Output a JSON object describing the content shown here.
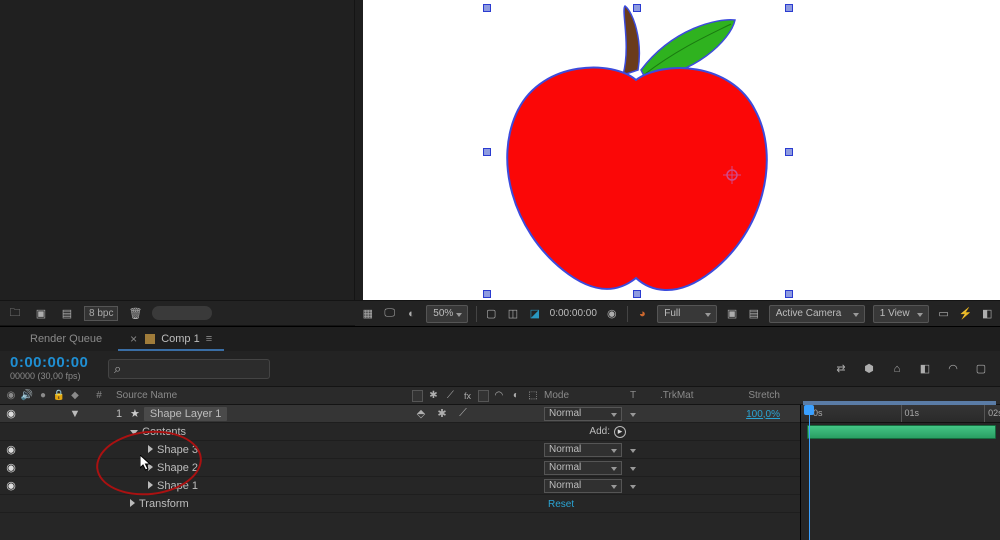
{
  "project_toolbar": {
    "bpc": "8 bpc"
  },
  "comp_toolbar": {
    "zoom": "50%",
    "time": "0:00:00:00",
    "resolution": "Full",
    "camera": "Active Camera",
    "views": "1 View"
  },
  "timeline": {
    "tabs": {
      "render_queue": "Render Queue",
      "comp": "Comp 1"
    },
    "timecode": "0:00:00:00",
    "timecode_sub": "00000 (30,00 fps)",
    "search_placeholder": "",
    "columns": {
      "index": "#",
      "source_name": "Source Name",
      "mode": "Mode",
      "t": "T",
      "trkmat": ".TrkMat",
      "stretch": "Stretch"
    },
    "layer": {
      "index": "1",
      "name": "Shape Layer 1",
      "mode": "Normal",
      "stretch": "100,0%"
    },
    "contents_label": "Contents",
    "add_label": "Add:",
    "shapes": [
      {
        "name": "Shape 3",
        "mode": "Normal"
      },
      {
        "name": "Shape 2",
        "mode": "Normal"
      },
      {
        "name": "Shape 1",
        "mode": "Normal"
      }
    ],
    "transform_label": "Transform",
    "reset_label": "Reset",
    "ruler": [
      "0s",
      "01s",
      "02s"
    ]
  }
}
